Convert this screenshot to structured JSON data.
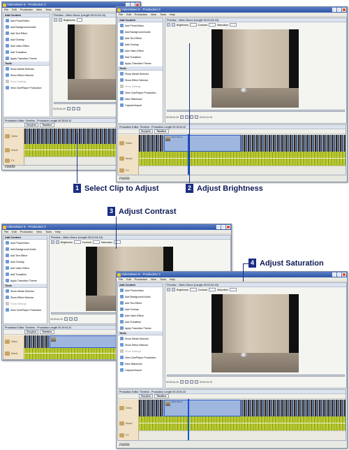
{
  "window": {
    "title": "VideoWave 8 - Production 2",
    "menu": [
      "File",
      "Edit",
      "Production",
      "View",
      "Tools",
      "Help"
    ]
  },
  "tasks": {
    "add_content_header": "Add Content",
    "add_content": [
      "Add Photo/Video",
      "Add Background Audio",
      "Add Text Effect",
      "Add Overlay",
      "Add Video Effect",
      "Add Transition",
      "Apply Transition Theme"
    ],
    "tools_header": "Tools",
    "tools": [
      "Show Media Selector",
      "Show Effect Selector",
      "Show Settings",
      "View CinePlayer Production",
      "New Slideshow",
      "Capture/Import"
    ]
  },
  "preview": {
    "title": "Preview - Video Decor (Length 00:01:04.15)",
    "brightness_label": "Brightness",
    "contrast_label": "Contrast",
    "saturation_label": "Saturation",
    "timecode_current": "00:00:44.20",
    "timecode_end": "00:01:04.15"
  },
  "timeline": {
    "title": "Production Editor: Timeline - Production Length 00:15:04.32",
    "tabs": [
      "Storyline",
      "Timeline"
    ],
    "tracks": [
      "Video",
      "Music",
      "FX"
    ],
    "clip_label": "Video Decor"
  },
  "logo": "roxio",
  "callouts": [
    {
      "num": "1",
      "text": "Select Clip to Adjust"
    },
    {
      "num": "2",
      "text": "Adjust Brightness"
    },
    {
      "num": "3",
      "text": "Adjust Contrast"
    },
    {
      "num": "4",
      "text": "Adjust Saturation"
    }
  ]
}
